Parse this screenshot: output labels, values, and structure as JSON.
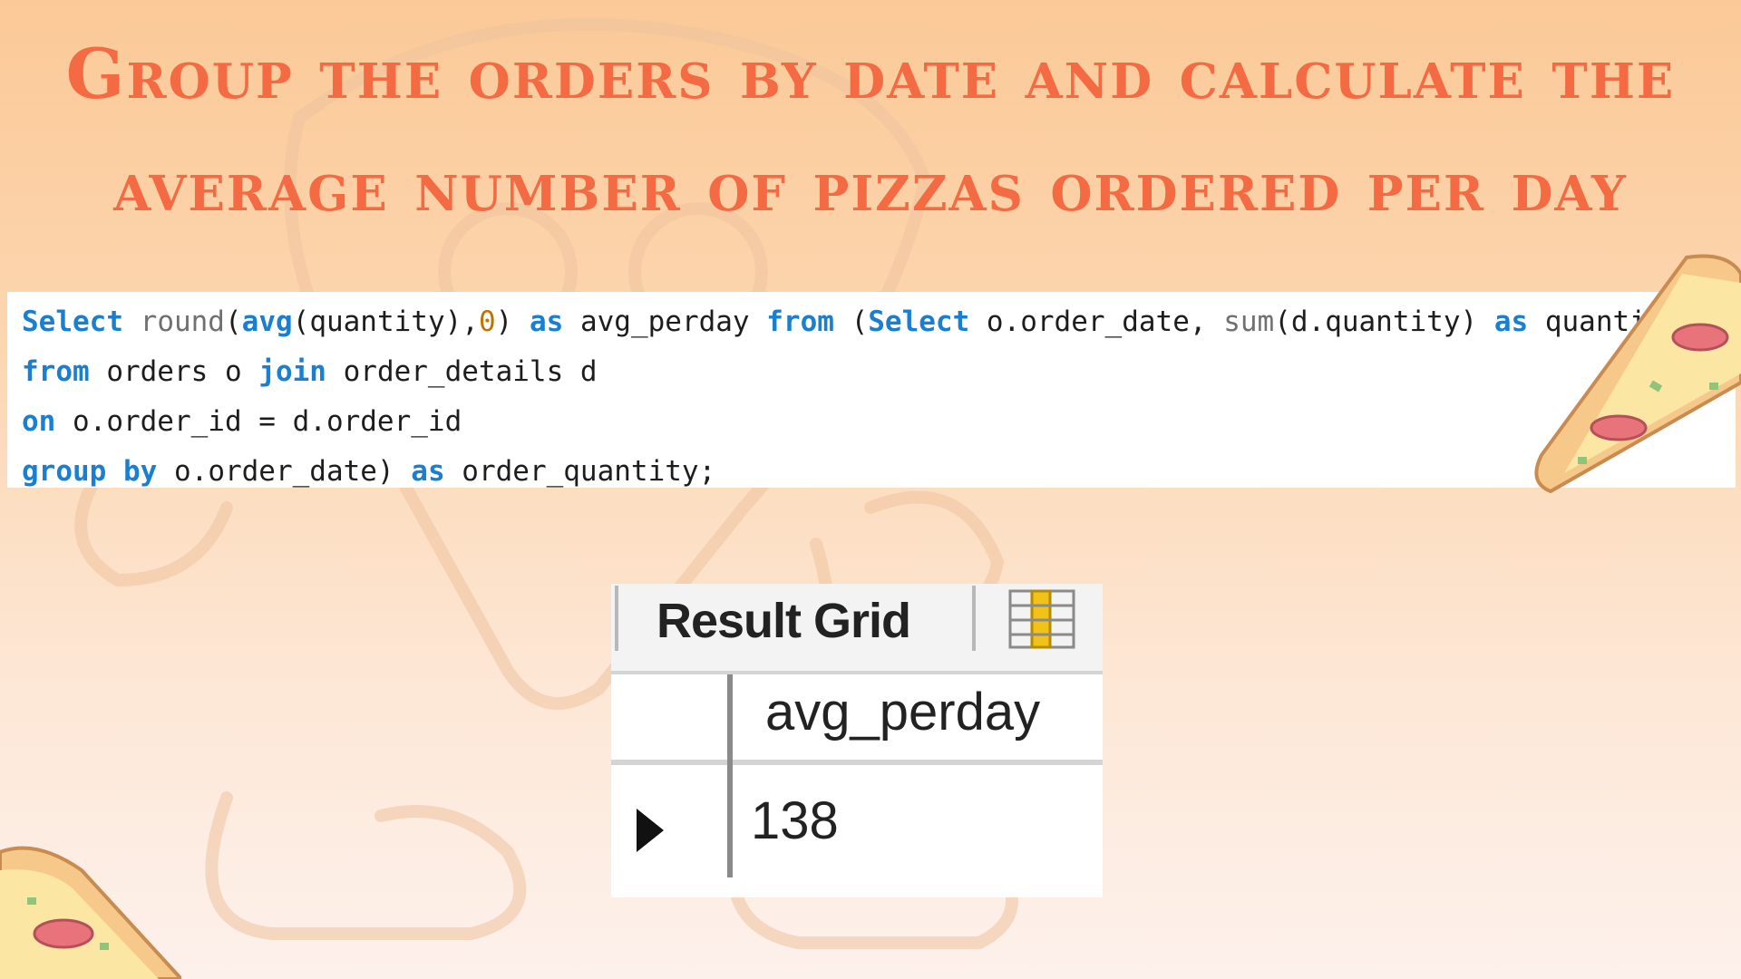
{
  "slide": {
    "title_line1": "Group the orders by date and calculate the",
    "title_line2": "average number of pizzas ordered per day"
  },
  "code": {
    "line1": {
      "select": "Select",
      "round": "round",
      "p1": "(",
      "avg": "avg",
      "p2": "(quantity),",
      "zero": "0",
      "p3": ") ",
      "as1": "as",
      "alias1": " avg_perday ",
      "from": "from",
      "p4": " (",
      "select2": "Select",
      "cols": " o.order_date, ",
      "sum": "sum",
      "p5": "(d.quantity) ",
      "as2": "as",
      "alias2": " quantity"
    },
    "line2": {
      "from": "from",
      "t1": " orders o ",
      "join": "join",
      "t2": " order_details d"
    },
    "line3": {
      "on": "on",
      "t1": " o.order_id = d.order_id"
    },
    "line4": {
      "group": "group",
      "by": " by",
      "t1": " o.order_date) ",
      "as": "as",
      "t2": " order_quantity;"
    }
  },
  "result_grid": {
    "tab_label": "Result Grid",
    "icon": "grid-columns-icon",
    "column_header": "avg_perday",
    "row_indicator_icon": "row-pointer-icon",
    "value": "138"
  },
  "colors": {
    "title": "#f36a43",
    "keyword": "#1a7fd1",
    "background_top": "#fbc997",
    "background_bottom": "#fdf1ec"
  }
}
